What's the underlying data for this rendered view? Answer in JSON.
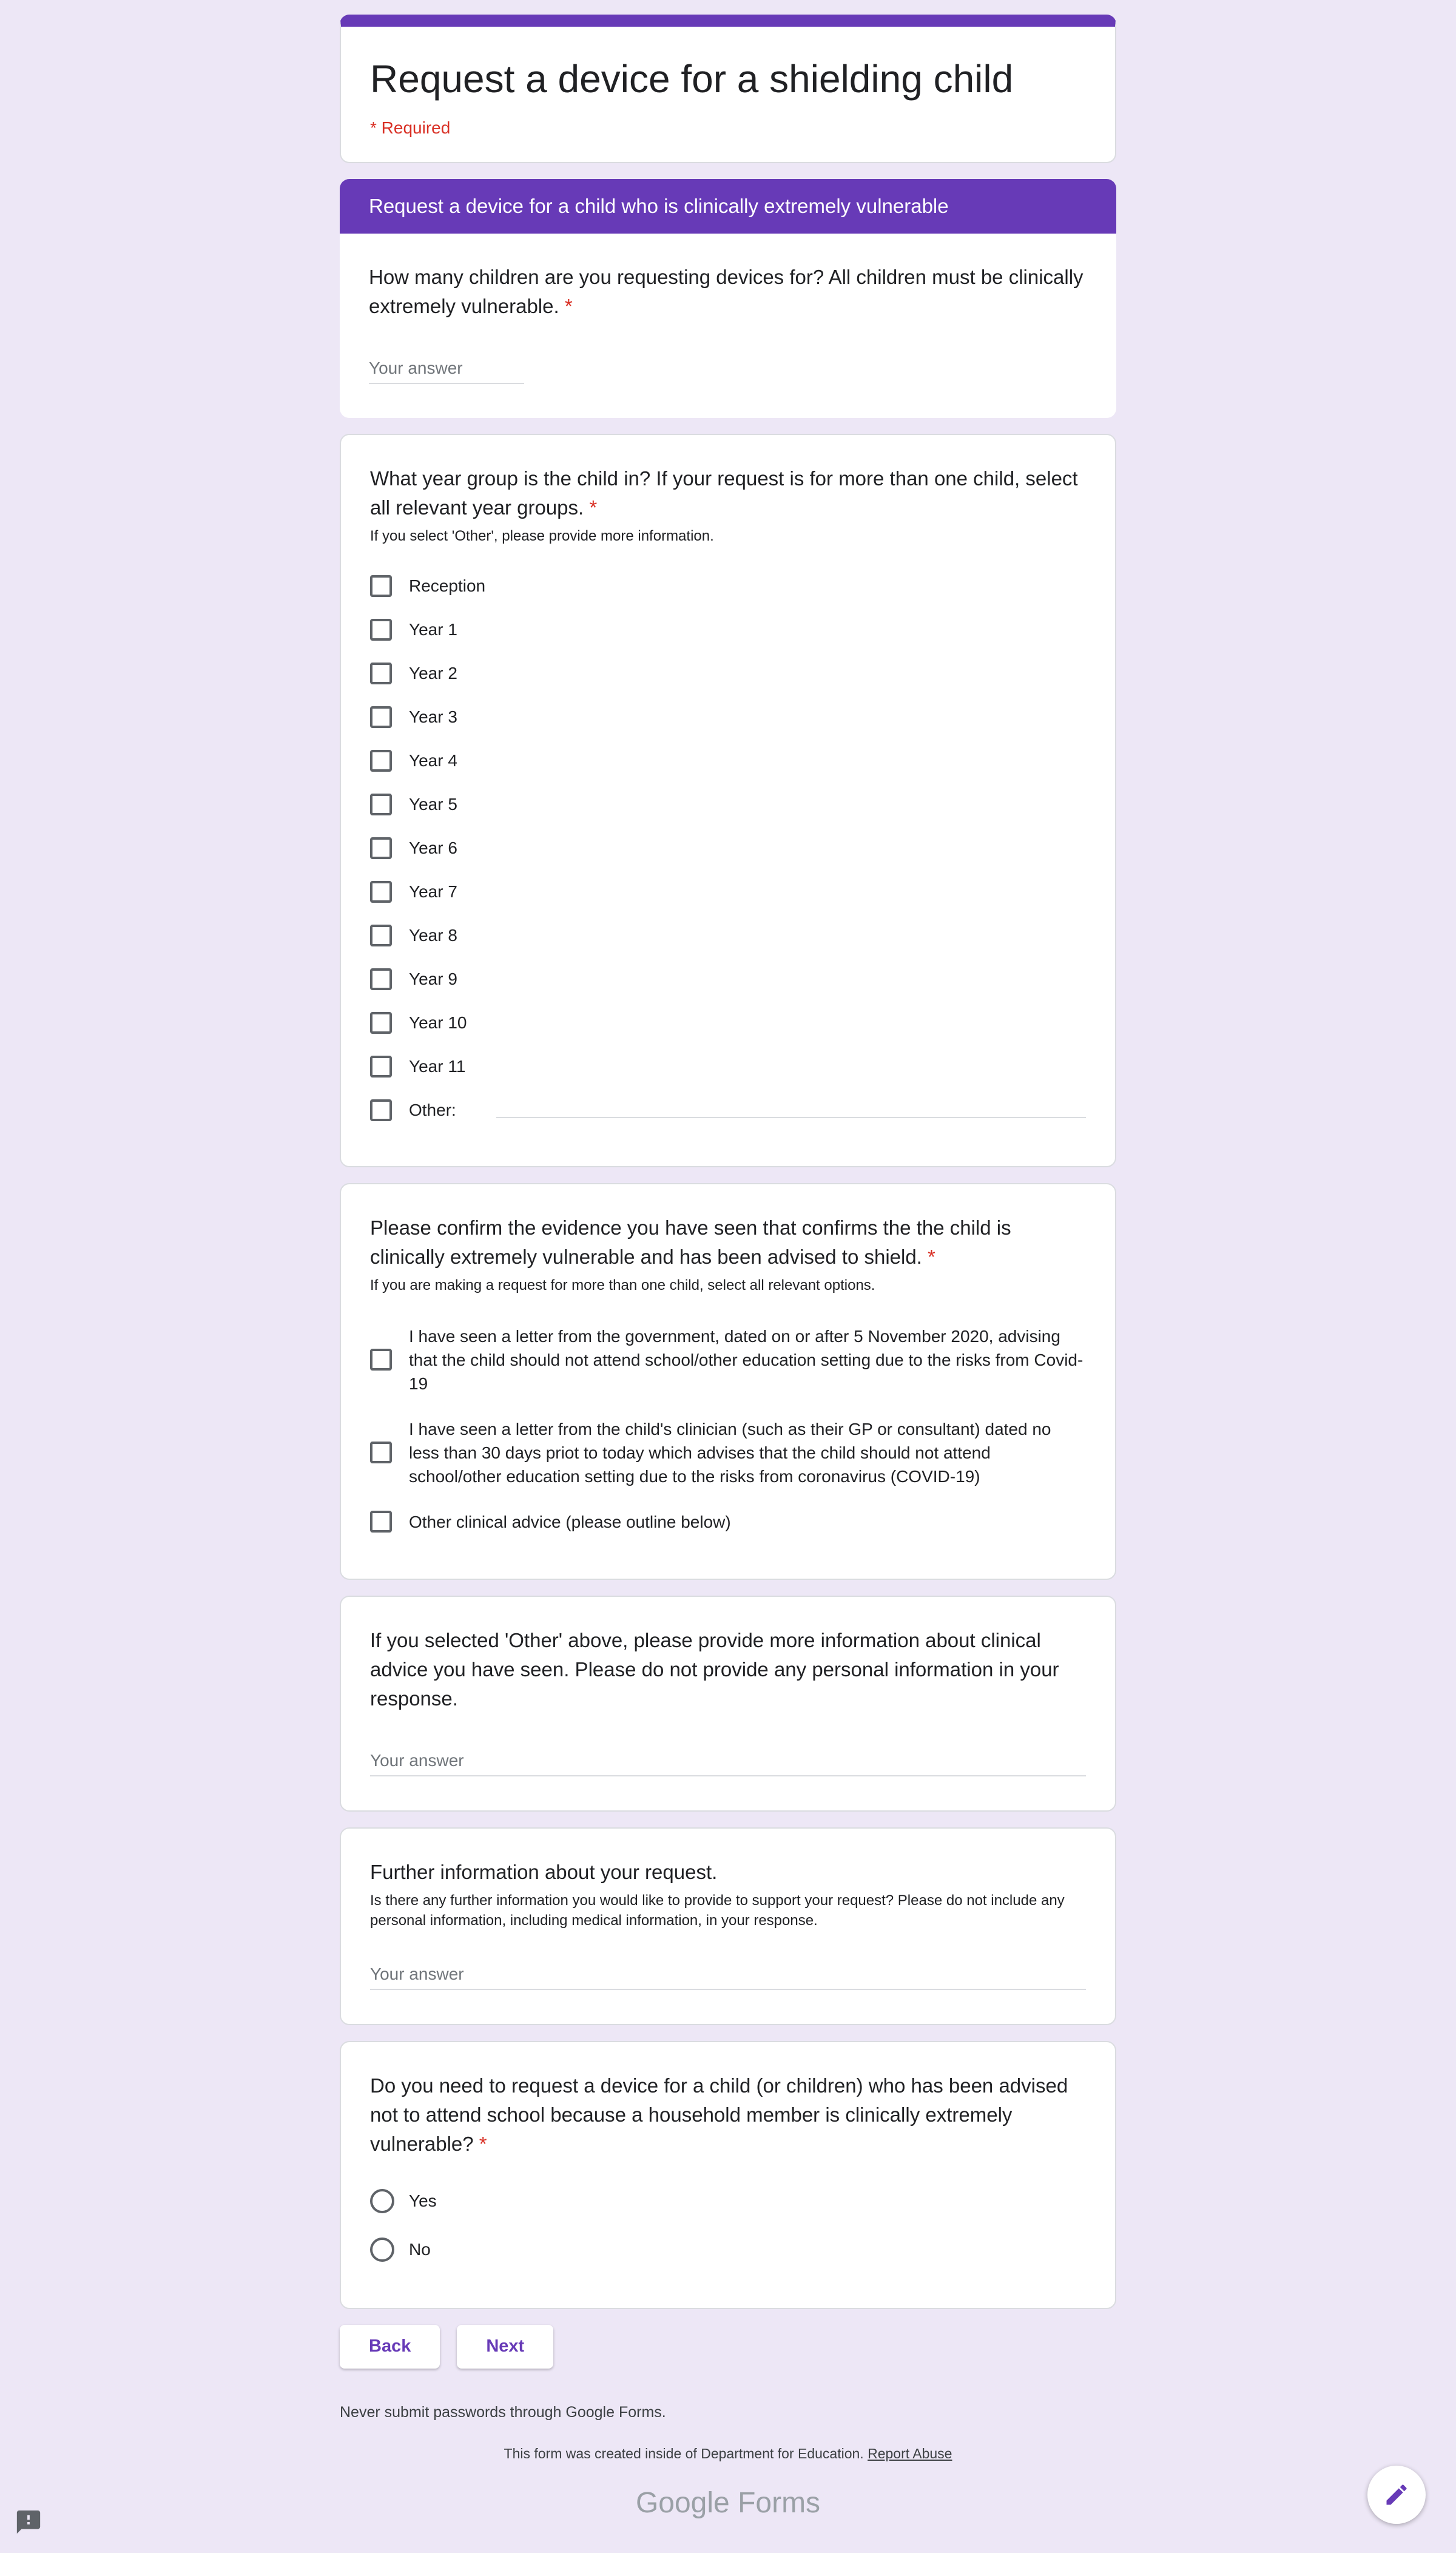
{
  "form": {
    "title": "Request a device for a shielding child",
    "required_note": "* Required"
  },
  "section": {
    "header": "Request a device for a child who is clinically extremely vulnerable"
  },
  "q1": {
    "title": "How many children are you requesting devices for? All children must be clinically extremely vulnerable.",
    "required_mark": "*",
    "placeholder": "Your answer"
  },
  "q2": {
    "title": "What year group is the child in? If your request is for more than one child, select all relevant year groups.",
    "required_mark": "*",
    "description": "If you select 'Other', please provide more information.",
    "options": [
      "Reception",
      "Year 1",
      "Year 2",
      "Year 3",
      "Year 4",
      "Year 5",
      "Year 6",
      "Year 7",
      "Year 8",
      "Year 9",
      "Year 10",
      "Year 11"
    ],
    "other_label": "Other:"
  },
  "q3": {
    "title": "Please confirm the evidence you have seen that confirms the the child is clinically extremely vulnerable and has been advised to shield.",
    "required_mark": "*",
    "description": "If you are making a request for more than one child, select all relevant options.",
    "options": [
      "I have seen a letter from the government, dated on or after 5 November 2020, advising that the child should not attend school/other education setting due to the risks from Covid-19",
      "I have seen a letter from the child's clinician (such as their GP or consultant) dated no less than 30 days priot to today which advises that the child should not attend school/other education setting due to the risks from coronavirus (COVID-19)",
      "Other clinical advice (please outline below)"
    ]
  },
  "q4": {
    "title": "If you selected 'Other' above, please provide more information about clinical advice you have seen. Please do not provide any personal information in your response.",
    "placeholder": "Your answer"
  },
  "q5": {
    "title": "Further information about your request.",
    "description": "Is there any further information you would like to provide to support your request? Please do not include any personal information, including medical information, in your response.",
    "placeholder": "Your answer"
  },
  "q6": {
    "title": "Do you need to request a device for a child (or children) who has been advised not to attend school because a household member is clinically extremely vulnerable?",
    "required_mark": "*",
    "options": [
      "Yes",
      "No"
    ]
  },
  "nav": {
    "back_label": "Back",
    "next_label": "Next"
  },
  "footer": {
    "warning": "Never submit passwords through Google Forms.",
    "created_text": "This form was created inside of Department for Education.",
    "report_link": "Report Abuse",
    "brand_google": "Google",
    "brand_forms": "Forms"
  },
  "icons": {
    "fab": "pencil-icon",
    "report": "report-issue-icon"
  },
  "colors": {
    "accent": "#673ab7",
    "background": "#ede7f6",
    "required": "#d93025"
  }
}
